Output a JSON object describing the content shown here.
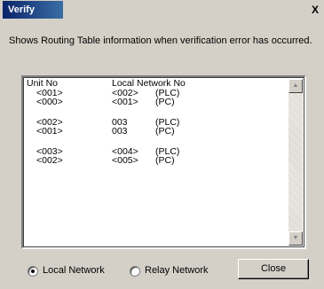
{
  "window": {
    "title": "Verify",
    "close_glyph": "X"
  },
  "description": "Shows Routing Table information when verification error has occurred.",
  "table": {
    "headers": {
      "unit": "Unit No",
      "network": "Local Network No"
    },
    "groups": [
      [
        [
          "<001>",
          "<002>",
          "(PLC)"
        ],
        [
          "<000>",
          "<001>",
          "(PC)"
        ]
      ],
      [
        [
          "<002>",
          "003",
          "(PLC)"
        ],
        [
          "<001>",
          "003",
          "(PC)"
        ]
      ],
      [
        [
          "<003>",
          "<004>",
          "(PLC)"
        ],
        [
          "<002>",
          "<005>",
          "(PC)"
        ]
      ]
    ]
  },
  "scrollbar": {
    "up_icon": "triangle-up-icon",
    "down_icon": "triangle-down-icon"
  },
  "radios": {
    "local": {
      "label": "Local Network",
      "selected": true
    },
    "relay": {
      "label": "Relay Network",
      "selected": false
    }
  },
  "buttons": {
    "close": "Close"
  }
}
